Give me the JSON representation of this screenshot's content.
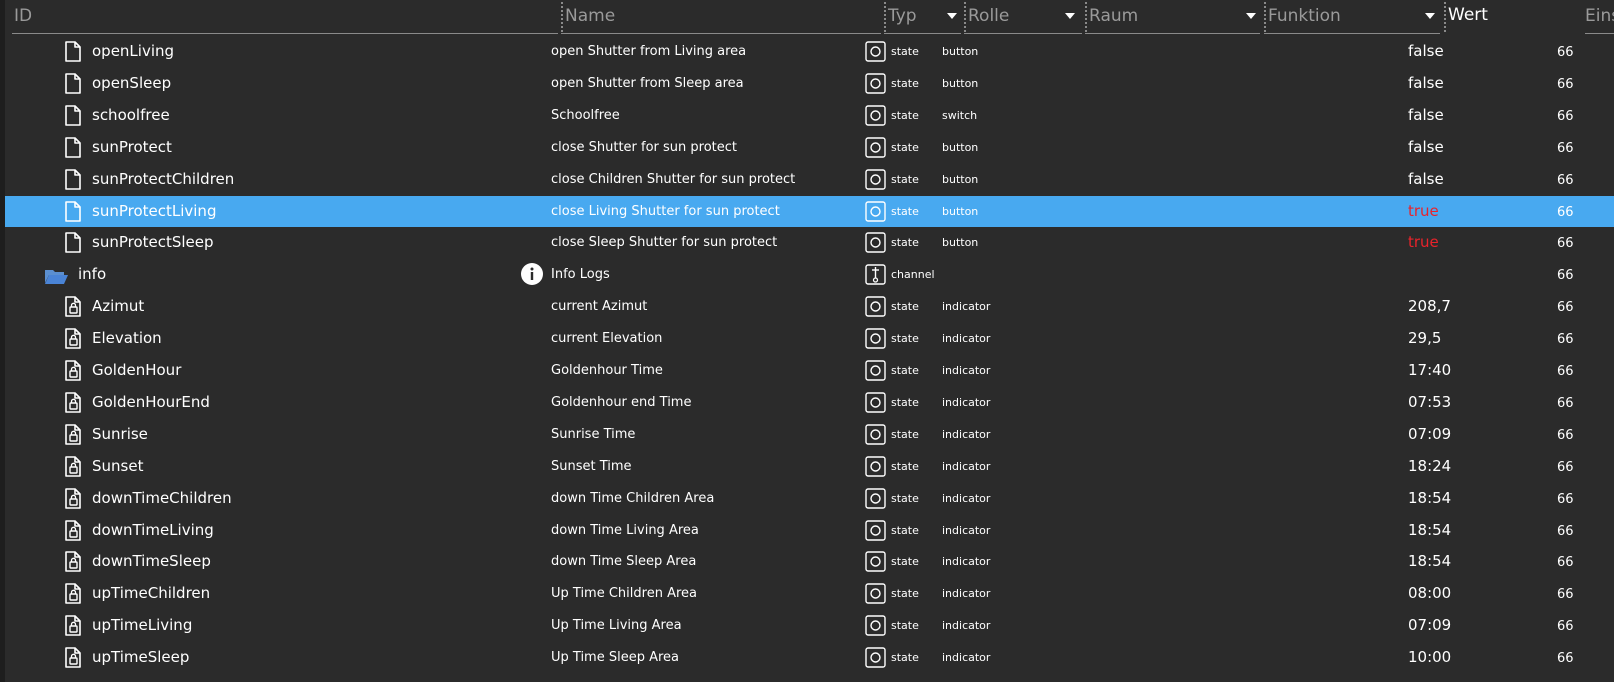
{
  "colors": {
    "background": "#2b2b2b",
    "selected_row": "#48a9f0",
    "true_value": "#e8232b",
    "header_text": "#9a9a9a"
  },
  "header": {
    "id": "ID",
    "name": "Name",
    "type": "Typ",
    "role": "Rolle",
    "room": "Raum",
    "function": "Funktion",
    "value": "Wert",
    "settings": "Eins"
  },
  "rows": [
    {
      "icon": "file-icon",
      "id": "openLiving",
      "name": "open Shutter from Living area",
      "type": "state",
      "role": "button",
      "value": "false",
      "eins": "66",
      "selected": false
    },
    {
      "icon": "file-icon",
      "id": "openSleep",
      "name": "open Shutter from Sleep area",
      "type": "state",
      "role": "button",
      "value": "false",
      "eins": "66",
      "selected": false
    },
    {
      "icon": "file-icon",
      "id": "schoolfree",
      "name": "Schoolfree",
      "type": "state",
      "role": "switch",
      "value": "false",
      "eins": "66",
      "selected": false
    },
    {
      "icon": "file-icon",
      "id": "sunProtect",
      "name": "close Shutter for sun protect",
      "type": "state",
      "role": "button",
      "value": "false",
      "eins": "66",
      "selected": false
    },
    {
      "icon": "file-icon",
      "id": "sunProtectChildren",
      "name": "close Children Shutter for sun protect",
      "type": "state",
      "role": "button",
      "value": "false",
      "eins": "66",
      "selected": false
    },
    {
      "icon": "file-icon",
      "id": "sunProtectLiving",
      "name": "close Living Shutter for sun protect",
      "type": "state",
      "role": "button",
      "value": "true",
      "eins": "66",
      "selected": true
    },
    {
      "icon": "file-icon",
      "id": "sunProtectSleep",
      "name": "close Sleep Shutter for sun protect",
      "type": "state",
      "role": "button",
      "value": "true",
      "eins": "66",
      "selected": false
    },
    {
      "icon": "folder-open-icon",
      "id": "info",
      "name": "Info Logs",
      "type": "channel",
      "role": "",
      "value": "",
      "eins": "66",
      "selected": false
    },
    {
      "icon": "file-lock-icon",
      "id": "Azimut",
      "name": "current Azimut",
      "type": "state",
      "role": "indicator",
      "value": "208,7",
      "eins": "66",
      "selected": false
    },
    {
      "icon": "file-lock-icon",
      "id": "Elevation",
      "name": "current Elevation",
      "type": "state",
      "role": "indicator",
      "value": "29,5",
      "eins": "66",
      "selected": false
    },
    {
      "icon": "file-lock-icon",
      "id": "GoldenHour",
      "name": "Goldenhour Time",
      "type": "state",
      "role": "indicator",
      "value": "17:40",
      "eins": "66",
      "selected": false
    },
    {
      "icon": "file-lock-icon",
      "id": "GoldenHourEnd",
      "name": "Goldenhour end Time",
      "type": "state",
      "role": "indicator",
      "value": "07:53",
      "eins": "66",
      "selected": false
    },
    {
      "icon": "file-lock-icon",
      "id": "Sunrise",
      "name": "Sunrise Time",
      "type": "state",
      "role": "indicator",
      "value": "07:09",
      "eins": "66",
      "selected": false
    },
    {
      "icon": "file-lock-icon",
      "id": "Sunset",
      "name": "Sunset Time",
      "type": "state",
      "role": "indicator",
      "value": "18:24",
      "eins": "66",
      "selected": false
    },
    {
      "icon": "file-lock-icon",
      "id": "downTimeChildren",
      "name": "down Time Children Area",
      "type": "state",
      "role": "indicator",
      "value": "18:54",
      "eins": "66",
      "selected": false
    },
    {
      "icon": "file-lock-icon",
      "id": "downTimeLiving",
      "name": "down Time Living Area",
      "type": "state",
      "role": "indicator",
      "value": "18:54",
      "eins": "66",
      "selected": false
    },
    {
      "icon": "file-lock-icon",
      "id": "downTimeSleep",
      "name": "down Time Sleep Area",
      "type": "state",
      "role": "indicator",
      "value": "18:54",
      "eins": "66",
      "selected": false
    },
    {
      "icon": "file-lock-icon",
      "id": "upTimeChildren",
      "name": "Up Time Children Area",
      "type": "state",
      "role": "indicator",
      "value": "08:00",
      "eins": "66",
      "selected": false
    },
    {
      "icon": "file-lock-icon",
      "id": "upTimeLiving",
      "name": "Up Time Living Area",
      "type": "state",
      "role": "indicator",
      "value": "07:09",
      "eins": "66",
      "selected": false
    },
    {
      "icon": "file-lock-icon",
      "id": "upTimeSleep",
      "name": "Up Time Sleep Area",
      "type": "state",
      "role": "indicator",
      "value": "10:00",
      "eins": "66",
      "selected": false
    }
  ]
}
